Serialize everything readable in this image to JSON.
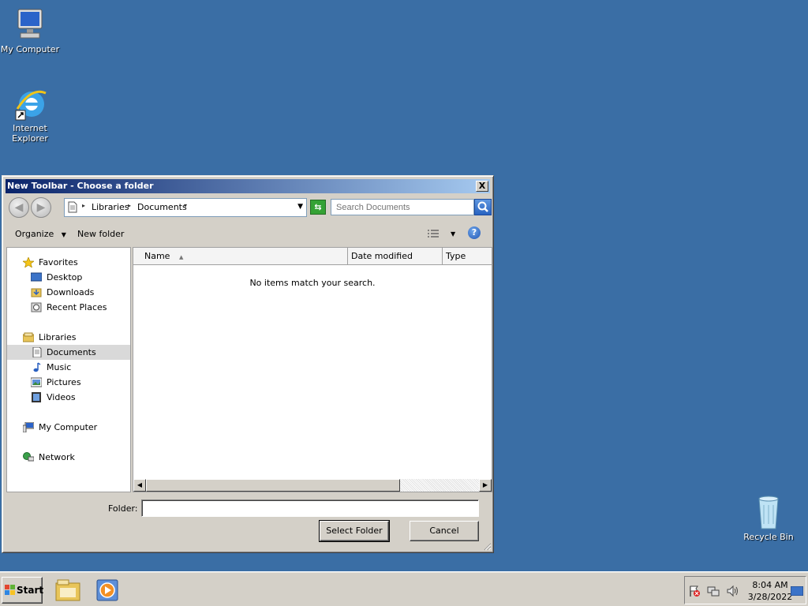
{
  "desktop": {
    "icons": [
      {
        "label": "My Computer"
      },
      {
        "label": "Internet Explorer"
      },
      {
        "label": "Recycle Bin"
      }
    ]
  },
  "dialog": {
    "title": "New Toolbar - Choose a folder",
    "close_glyph": "X",
    "breadcrumb": [
      "Libraries",
      "Documents"
    ],
    "search_placeholder": "Search Documents",
    "commands": {
      "organize": "Organize",
      "new_folder": "New folder"
    },
    "help_glyph": "?",
    "nav_pane": {
      "favorites": {
        "label": "Favorites",
        "items": [
          "Desktop",
          "Downloads",
          "Recent Places"
        ]
      },
      "libraries": {
        "label": "Libraries",
        "items": [
          "Documents",
          "Music",
          "Pictures",
          "Videos"
        ],
        "selected": "Documents"
      },
      "my_computer": "My Computer",
      "network": "Network"
    },
    "columns": [
      "Name",
      "Date modified",
      "Type"
    ],
    "empty_message": "No items match your search.",
    "folder_label": "Folder:",
    "folder_value": "",
    "select_button": "Select Folder",
    "cancel_button": "Cancel"
  },
  "taskbar": {
    "start_label": "Start",
    "clock_time": "8:04 AM",
    "clock_date": "3/28/2022"
  },
  "colors": {
    "desktop_bg": "#3a6ea5",
    "title_start": "#0a246a",
    "title_end": "#a6caf0",
    "chrome": "#d4d0c8"
  }
}
